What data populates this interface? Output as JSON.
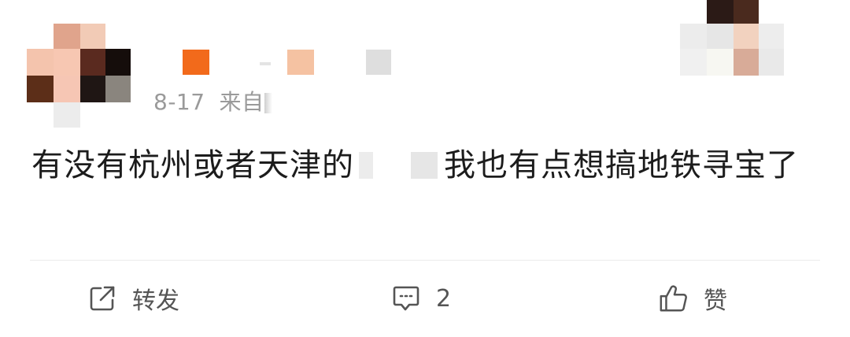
{
  "post": {
    "date": "8-17",
    "source_prefix": "来自",
    "text_part1": "有没有杭州或者天津的",
    "text_part2": "我也有点想搞地铁寻宝了"
  },
  "actions": {
    "repost_label": "转发",
    "comment_count": "2",
    "like_label": "赞"
  },
  "colors": {
    "text": "#1c1c1c",
    "meta": "#9a9a9a",
    "action": "#555555",
    "divider": "#ebebeb",
    "accent_orange": "#f26a1b"
  },
  "icons": {
    "repost": "repost-icon",
    "comment": "comment-icon",
    "like": "like-icon"
  }
}
